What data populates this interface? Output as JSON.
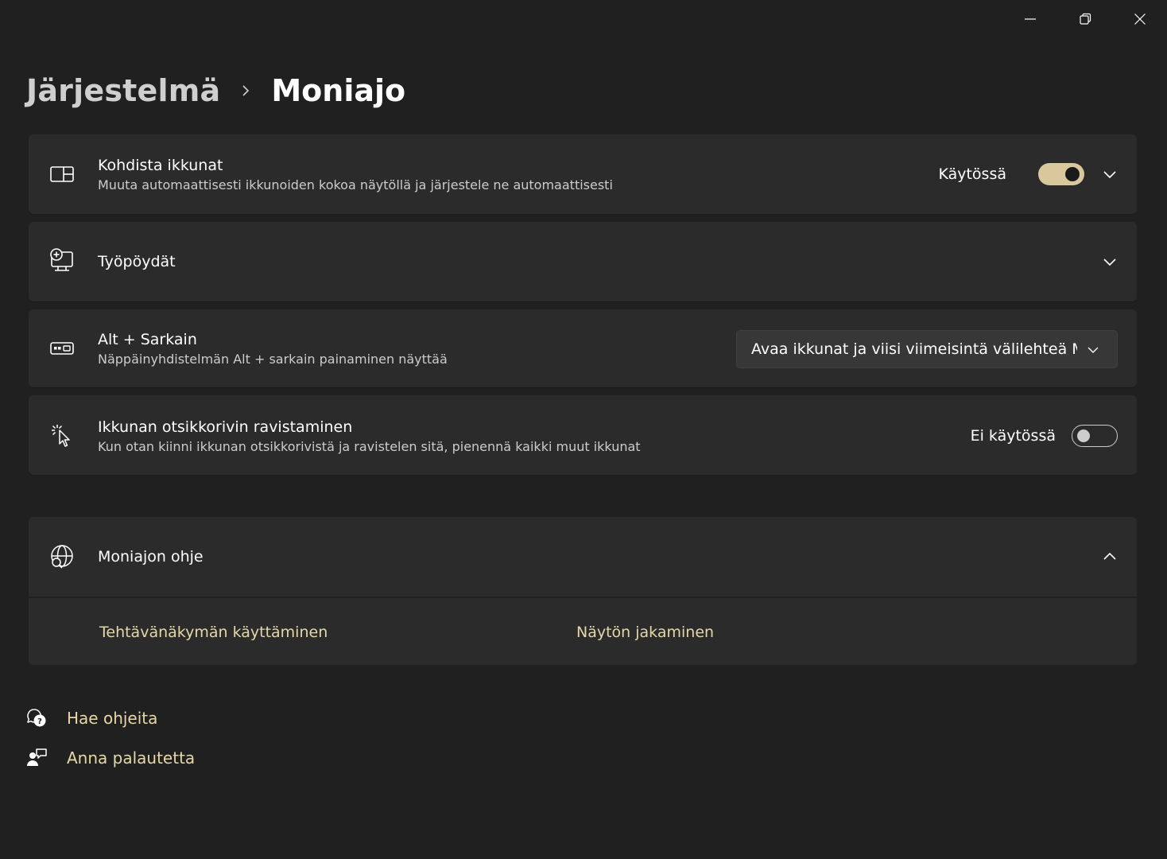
{
  "titlebar": {
    "minimize_icon": "minimize-icon",
    "restore_icon": "restore-icon",
    "close_icon": "close-icon"
  },
  "breadcrumb": {
    "parent": "Järjestelmä",
    "current": "Moniajo"
  },
  "settings": [
    {
      "icon": "snap-windows-icon",
      "title": "Kohdista ikkunat",
      "description": "Muuta automaattisesti ikkunoiden kokoa näytöllä ja järjestele ne automaattisesti",
      "control": "toggle",
      "state_label": "Käytössä",
      "state": true,
      "expandable": true
    },
    {
      "icon": "desktops-icon",
      "title": "Työpöydät",
      "expandable": true
    },
    {
      "icon": "alt-tab-icon",
      "title": "Alt + Sarkain",
      "description": "Näppäinyhdistelmän Alt + sarkain painaminen näyttää",
      "control": "dropdown",
      "selected": "Avaa ikkunat ja viisi viimeisintä välilehteä Mi"
    },
    {
      "icon": "title-bar-shake-icon",
      "title": "Ikkunan otsikkorivin ravistaminen",
      "description": "Kun otan kiinni ikkunan otsikkorivistä ja ravistelen sitä, pienennä kaikki muut ikkunat",
      "control": "toggle",
      "state_label": "Ei käytössä",
      "state": false
    }
  ],
  "help": {
    "icon": "web-search-icon",
    "title": "Moniajon ohje",
    "links": [
      "Tehtävänäkymän käyttäminen",
      "Näytön jakaminen"
    ]
  },
  "footer": {
    "get_help": "Hae ohjeita",
    "get_help_icon": "help-chat-icon",
    "feedback": "Anna palautetta",
    "feedback_icon": "feedback-icon"
  },
  "colors": {
    "background": "#202020",
    "card": "#2b2b2b",
    "accent": "#d8c89c",
    "link": "#e6d7a6"
  }
}
